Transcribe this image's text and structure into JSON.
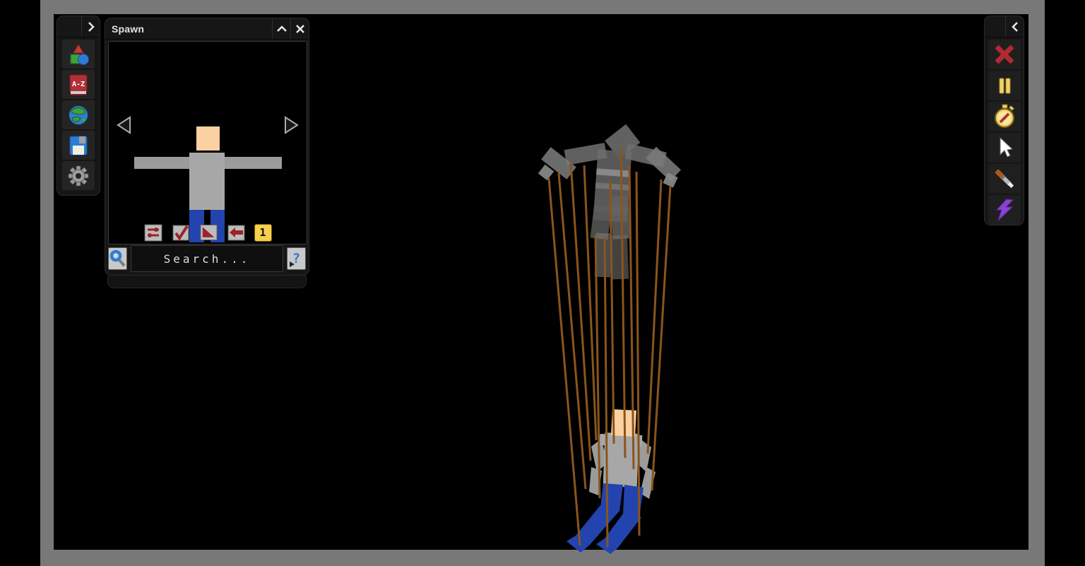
{
  "colors": {
    "wall": "#787878",
    "rope": "#8a551c",
    "skin": "#fcd1a2",
    "shirt": "#a7a7a7",
    "arm": "#9b9b9b",
    "pants": "#2344ae",
    "panel": "#161616",
    "slot": "#242424",
    "yellow": "#f2d267",
    "red": "#b02a30",
    "purple": "#8b41d8",
    "blue": "#2e7cd6",
    "icon_red": "#9b2328",
    "badge_yellow": "#f6cf4e"
  },
  "left_toolbar": {
    "tools": [
      {
        "name": "shapes"
      },
      {
        "name": "dictionary",
        "label": "A-Z"
      },
      {
        "name": "world"
      },
      {
        "name": "save"
      },
      {
        "name": "settings"
      }
    ]
  },
  "spawn_panel": {
    "title": "Spawn",
    "search_placeholder": "Search...",
    "spawn_count": "1",
    "help_glyph": "?"
  },
  "right_toolbar": {
    "tools": [
      {
        "name": "delete"
      },
      {
        "name": "pause"
      },
      {
        "name": "slow-motion"
      },
      {
        "name": "drag"
      },
      {
        "name": "scalpel"
      },
      {
        "name": "shock"
      }
    ]
  }
}
